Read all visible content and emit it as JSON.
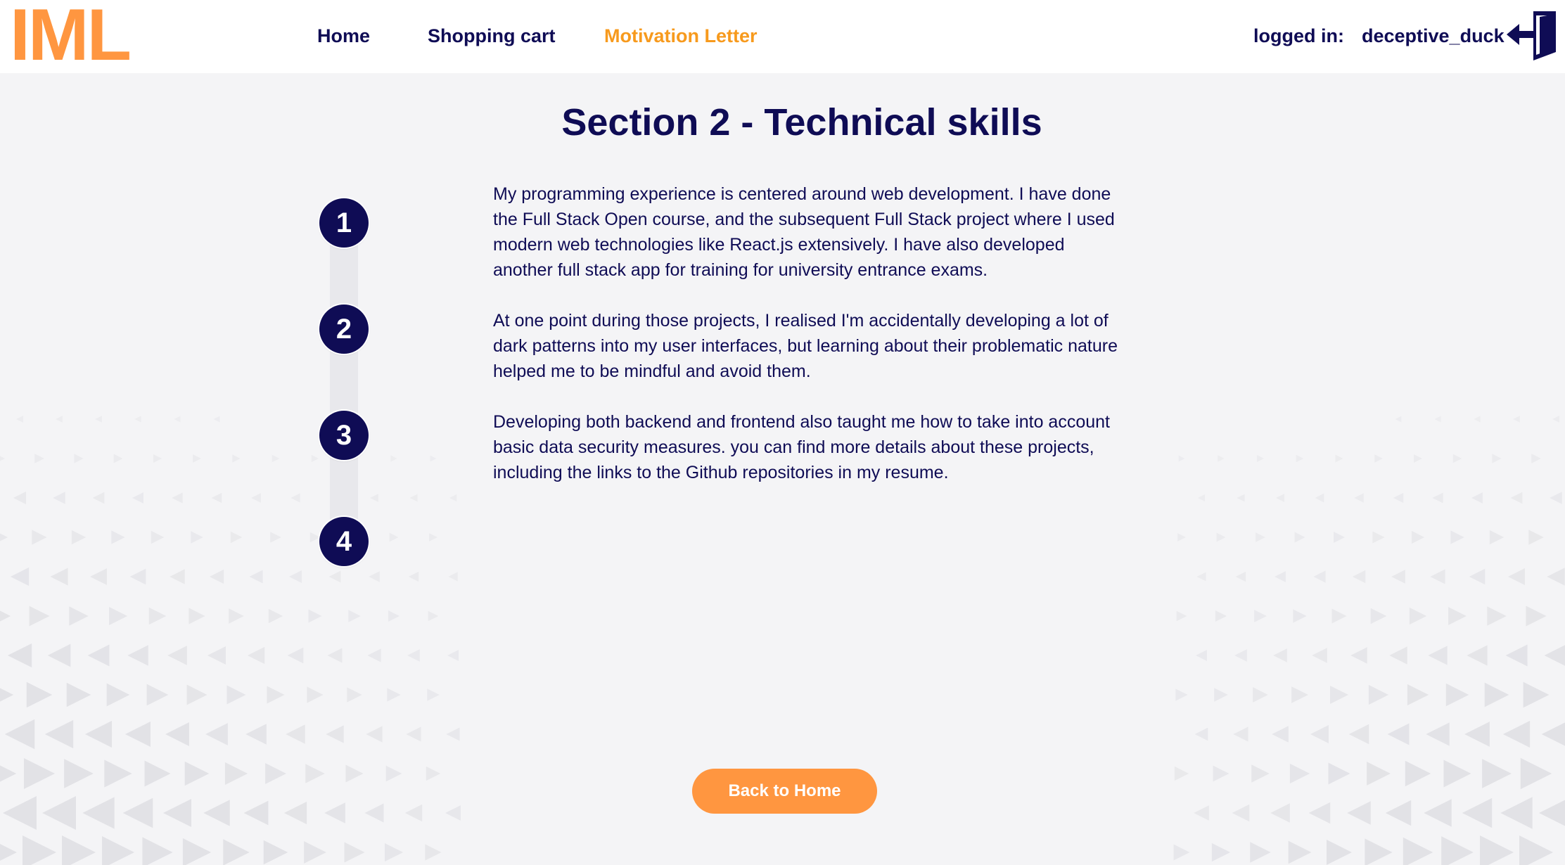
{
  "header": {
    "logo": "IML",
    "nav": [
      {
        "label": "Home",
        "active": false
      },
      {
        "label": "Shopping cart",
        "active": false
      },
      {
        "label": "Motivation Letter",
        "active": true
      }
    ],
    "login_label": "logged in:",
    "username": "deceptive_duck",
    "logout_icon": "logout-door-icon"
  },
  "main": {
    "title": "Section 2 - Technical skills",
    "steps": [
      "1",
      "2",
      "3",
      "4"
    ],
    "paragraphs": [
      "My programming experience is centered around web development. I have done the Full Stack Open course, and the subsequent Full Stack project where I used modern web technologies like React.js extensively. I have also developed another full stack app for training for university entrance exams.",
      "At one point during those projects, I realised I'm accidentally developing a lot of dark patterns into my user interfaces, but learning about their problematic nature helped me to be mindful and avoid them.",
      "Developing both backend and frontend also taught me how to take into account basic data security measures. you can find more details about these projects, including the links to the Github repositories in my resume."
    ],
    "back_button": "Back to Home"
  },
  "colors": {
    "primary": "#0f0c55",
    "accent": "#ff9640",
    "active_nav": "#f79a1d",
    "background": "#f4f4f6"
  }
}
